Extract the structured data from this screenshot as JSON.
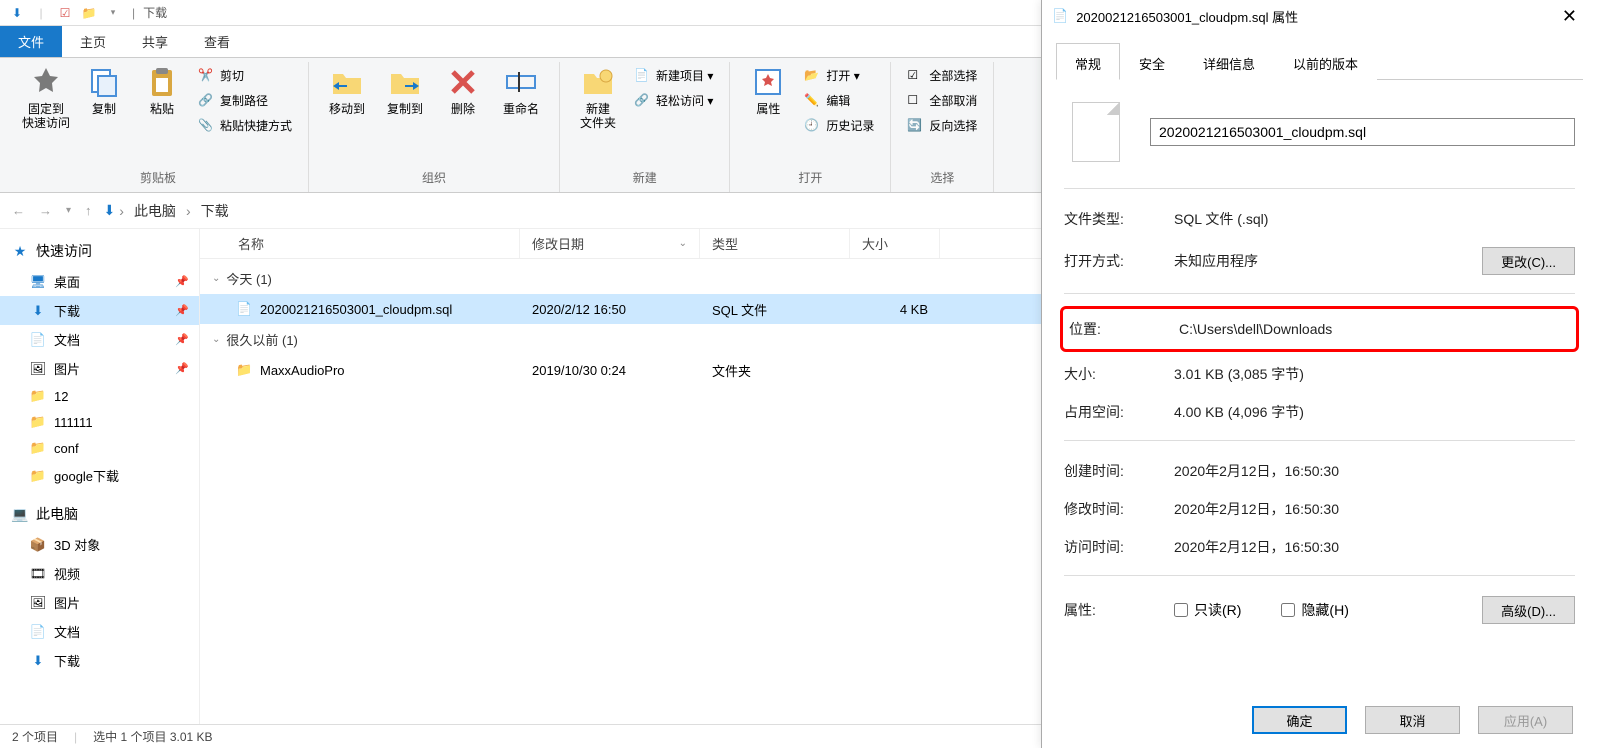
{
  "titlebar": {
    "title": "下载"
  },
  "tabs": {
    "file": "文件",
    "home": "主页",
    "share": "共享",
    "view": "查看"
  },
  "ribbon": {
    "clipboard": {
      "pin": "固定到\n快速访问",
      "copy": "复制",
      "paste": "粘贴",
      "cut": "剪切",
      "copypath": "复制路径",
      "pasteshort": "粘贴快捷方式",
      "group": "剪贴板"
    },
    "organize": {
      "moveto": "移动到",
      "copyto": "复制到",
      "delete": "删除",
      "rename": "重命名",
      "group": "组织"
    },
    "new_": {
      "newfolder": "新建\n文件夹",
      "newitem": "新建项目 ▾",
      "easyaccess": "轻松访问 ▾",
      "group": "新建"
    },
    "open": {
      "properties": "属性",
      "open_btn": "打开 ▾",
      "edit": "编辑",
      "history": "历史记录",
      "group": "打开"
    },
    "select": {
      "all": "全部选择",
      "none": "全部取消",
      "invert": "反向选择",
      "group": "选择"
    }
  },
  "breadcrumbs": {
    "thispc": "此电脑",
    "downloads": "下载"
  },
  "columns": {
    "name": "名称",
    "date": "修改日期",
    "type": "类型",
    "size": "大小"
  },
  "groups": {
    "today": {
      "label": "今天 (1)"
    },
    "longago": {
      "label": "很久以前 (1)"
    }
  },
  "files": [
    {
      "name": "2020021216503001_cloudpm.sql",
      "date": "2020/2/12 16:50",
      "type": "SQL 文件",
      "size": "4 KB"
    },
    {
      "name": "MaxxAudioPro",
      "date": "2019/10/30 0:24",
      "type": "文件夹",
      "size": ""
    }
  ],
  "sidebar": {
    "quick": "快速访问",
    "items1": [
      "桌面",
      "下载",
      "文档",
      "图片",
      "12",
      "111111",
      "conf",
      "google下载"
    ],
    "thispc": "此电脑",
    "items2": [
      "3D 对象",
      "视频",
      "图片",
      "文档",
      "下载"
    ]
  },
  "status": {
    "count": "2 个项目",
    "selected": "选中 1 个项目  3.01 KB"
  },
  "dialog": {
    "title": "2020021216503001_cloudpm.sql 属性",
    "tabs": {
      "general": "常规",
      "security": "安全",
      "details": "详细信息",
      "prev": "以前的版本"
    },
    "filename": "2020021216503001_cloudpm.sql",
    "rows": {
      "filetype_l": "文件类型:",
      "filetype_v": "SQL 文件 (.sql)",
      "opens_l": "打开方式:",
      "opens_v": "未知应用程序",
      "change_btn": "更改(C)...",
      "location_l": "位置:",
      "location_v": "C:\\Users\\dell\\Downloads",
      "size_l": "大小:",
      "size_v": "3.01 KB (3,085 字节)",
      "ondisk_l": "占用空间:",
      "ondisk_v": "4.00 KB (4,096 字节)",
      "created_l": "创建时间:",
      "created_v": "2020年2月12日，16:50:30",
      "modified_l": "修改时间:",
      "modified_v": "2020年2月12日，16:50:30",
      "accessed_l": "访问时间:",
      "accessed_v": "2020年2月12日，16:50:30",
      "attr_l": "属性:",
      "readonly": "只读(R)",
      "hidden": "隐藏(H)",
      "advanced": "高级(D)..."
    },
    "buttons": {
      "ok": "确定",
      "cancel": "取消",
      "apply": "应用(A)"
    }
  }
}
